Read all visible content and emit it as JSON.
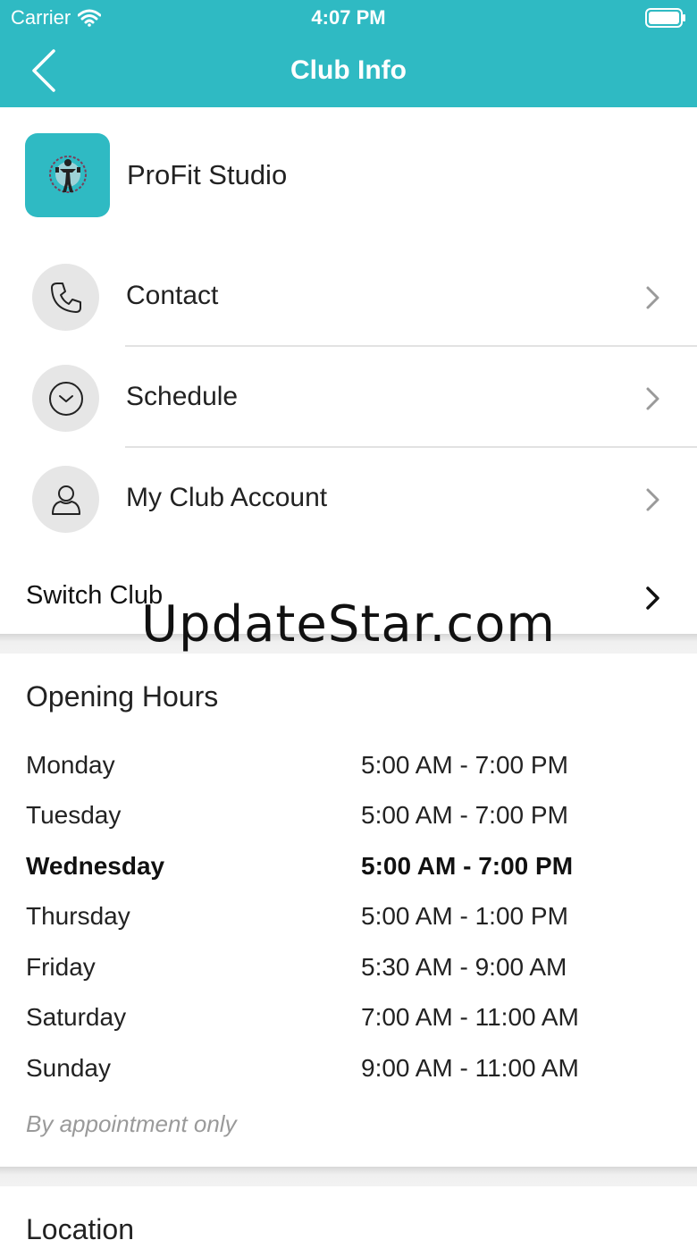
{
  "status_bar": {
    "carrier": "Carrier",
    "time": "4:07 PM",
    "wifi_icon": "wifi-icon",
    "battery_icon": "battery-icon"
  },
  "nav": {
    "title": "Club Info",
    "back_icon": "chevron-left-icon"
  },
  "club": {
    "name": "ProFit Studio",
    "logo_icon": "club-logo"
  },
  "menu": [
    {
      "label": "Contact",
      "icon": "phone-icon"
    },
    {
      "label": "Schedule",
      "icon": "clock-icon"
    },
    {
      "label": "My Club Account",
      "icon": "person-icon"
    }
  ],
  "switch_club": {
    "label": "Switch Club"
  },
  "watermark": "UpdateStar.com",
  "opening_hours": {
    "title": "Opening Hours",
    "rows": [
      {
        "day": "Monday",
        "time": "5:00 AM - 7:00 PM"
      },
      {
        "day": "Tuesday",
        "time": "5:00 AM - 7:00 PM"
      },
      {
        "day": "Wednesday",
        "time": "5:00 AM - 7:00 PM",
        "today": true
      },
      {
        "day": "Thursday",
        "time": "5:00 AM - 1:00 PM"
      },
      {
        "day": "Friday",
        "time": "5:30 AM - 9:00 AM"
      },
      {
        "day": "Saturday",
        "time": "7:00 AM - 11:00 AM"
      },
      {
        "day": "Sunday",
        "time": "9:00 AM - 11:00 AM"
      }
    ],
    "note": "By appointment only"
  },
  "location": {
    "title": "Location"
  },
  "colors": {
    "accent": "#2fbac3",
    "icon_circle": "#e6e6e6",
    "note_text": "#9a9a9a"
  }
}
